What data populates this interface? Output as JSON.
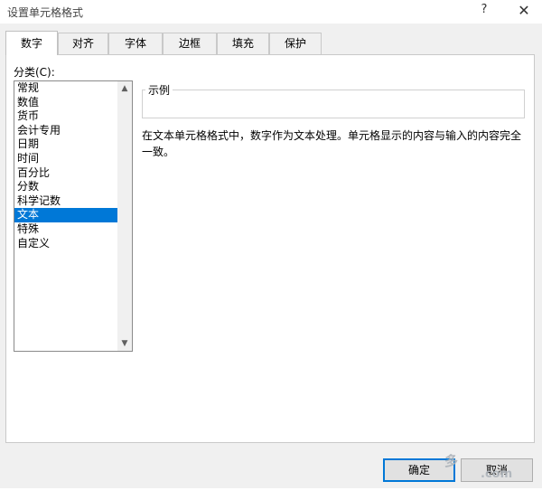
{
  "window": {
    "title": "设置单元格格式",
    "help_glyph": "?",
    "close_glyph": "✕"
  },
  "tabs": [
    {
      "label": "数字",
      "active": true
    },
    {
      "label": "对齐",
      "active": false
    },
    {
      "label": "字体",
      "active": false
    },
    {
      "label": "边框",
      "active": false
    },
    {
      "label": "填充",
      "active": false
    },
    {
      "label": "保护",
      "active": false
    }
  ],
  "category": {
    "label": "分类(C):",
    "items": [
      "常规",
      "数值",
      "货币",
      "会计专用",
      "日期",
      "时间",
      "百分比",
      "分数",
      "科学记数",
      "文本",
      "特殊",
      "自定义"
    ],
    "selected": "文本",
    "scroll_up": "▲",
    "scroll_down": "▼"
  },
  "sample": {
    "legend": "示例",
    "value": ""
  },
  "description": "在文本单元格格式中，数字作为文本处理。单元格显示的内容与输入的内容完全一致。",
  "buttons": {
    "ok": "确定",
    "cancel": "取消"
  },
  "watermark": {
    "line1": "多",
    "line2": ".com"
  },
  "colors": {
    "selection": "#0078d7",
    "dialog_bg": "#f0f0f0"
  }
}
